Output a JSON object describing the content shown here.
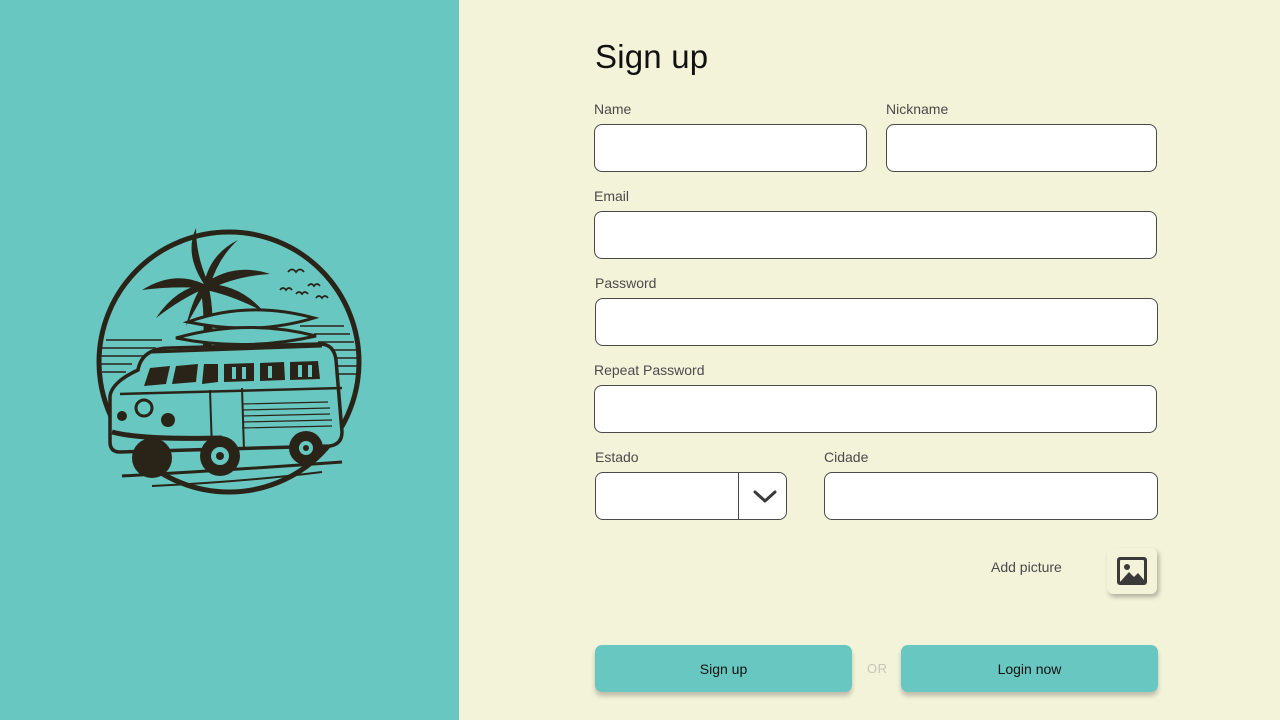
{
  "form": {
    "title": "Sign up",
    "fields": {
      "name": {
        "label": "Name",
        "value": ""
      },
      "nickname": {
        "label": "Nickname",
        "value": ""
      },
      "email": {
        "label": "Email",
        "value": ""
      },
      "password": {
        "label": "Password",
        "value": ""
      },
      "repeat_password": {
        "label": "Repeat Password",
        "value": ""
      },
      "estado": {
        "label": "Estado",
        "selected": ""
      },
      "cidade": {
        "label": "Cidade",
        "value": ""
      }
    },
    "add_picture_label": "Add picture",
    "picture_icon": "image-icon",
    "signup_button": "Sign up",
    "or_text": "OR",
    "login_button": "Login now"
  },
  "logo": {
    "icon": "van-palm-tree-logo"
  },
  "colors": {
    "accent": "#68c7c1",
    "background": "#f3f3da",
    "ink": "#2a2418"
  }
}
